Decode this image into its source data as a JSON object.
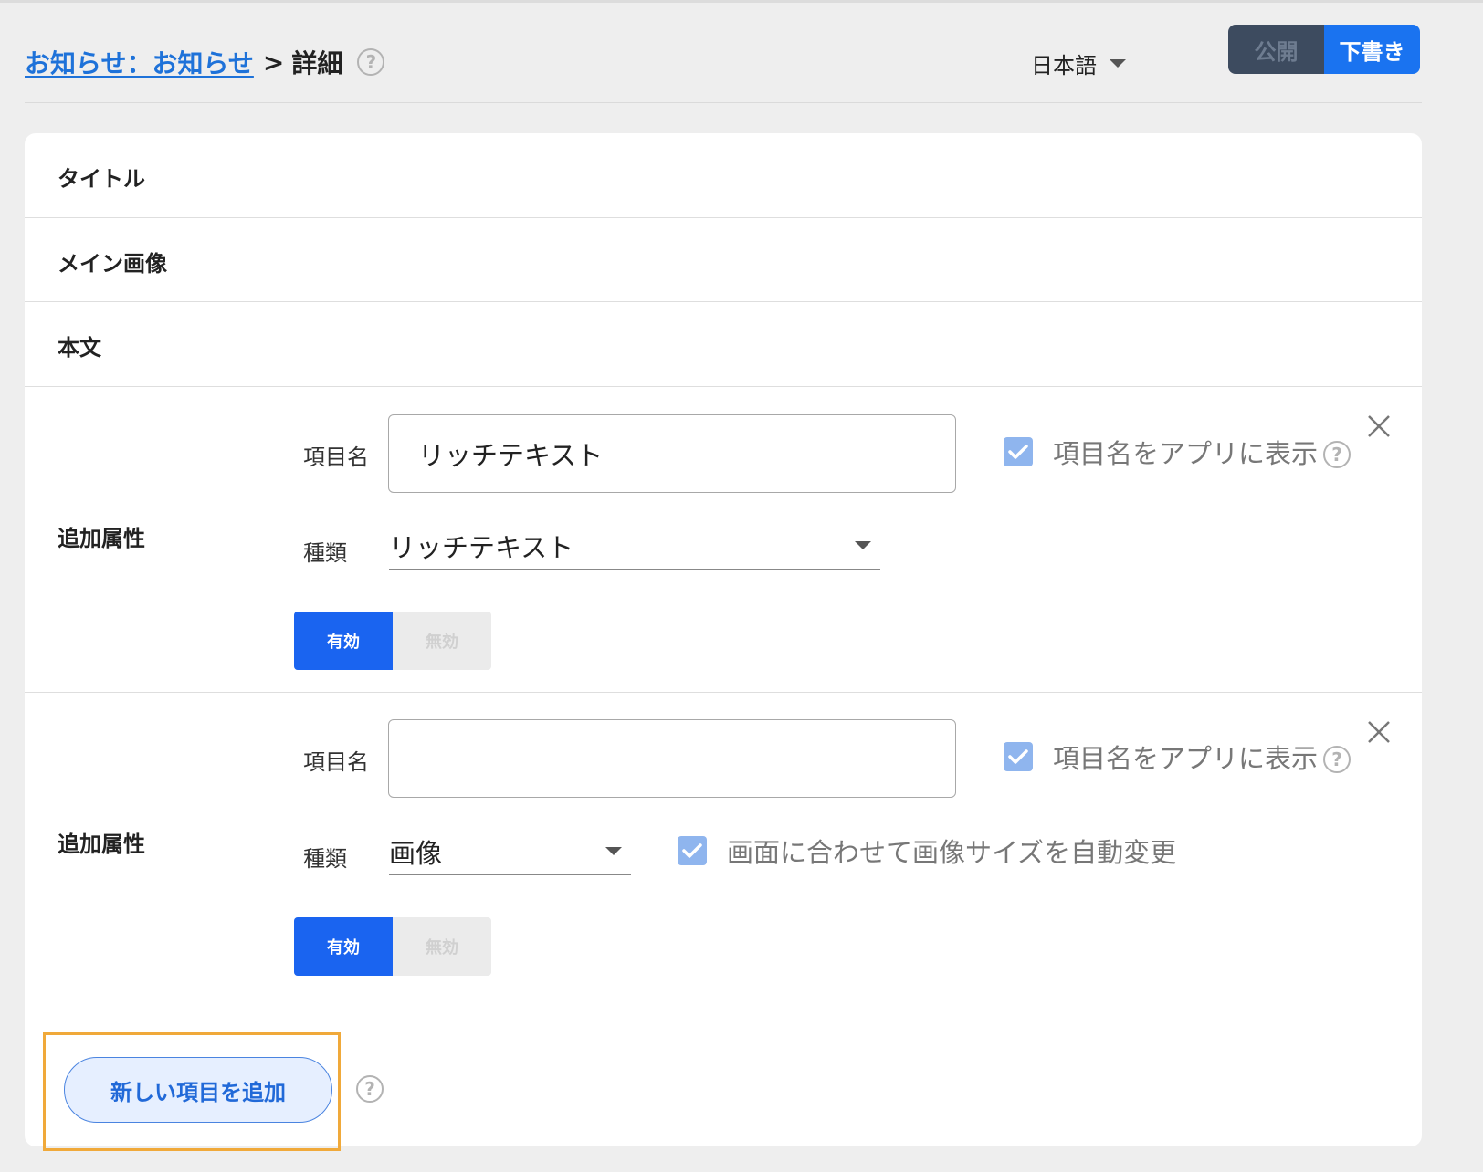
{
  "breadcrumb": {
    "link": "お知らせ：お知らせ ",
    "separator": ">",
    "current": "詳細",
    "help": "?"
  },
  "language": {
    "selected": "日本語"
  },
  "publish_toggle": {
    "publish_label": "公開",
    "draft_label": "下書き",
    "active": "下書き"
  },
  "sections": [
    {
      "label": "タイトル"
    },
    {
      "label": "メイン画像"
    },
    {
      "label": "本文"
    }
  ],
  "attributes": [
    {
      "label": "追加属性",
      "name_label": "項目名",
      "name_value": "リッチテキスト",
      "show_name_label": "項目名をアプリに表示",
      "show_name_checked": true,
      "type_label": "種類",
      "type_value": "リッチテキスト",
      "enabled_label": "有効",
      "disabled_label": "無効",
      "state": "有効"
    },
    {
      "label": "追加属性",
      "name_label": "項目名",
      "name_value": "",
      "show_name_label": "項目名をアプリに表示",
      "show_name_checked": true,
      "type_label": "種類",
      "type_value": "画像",
      "auto_resize_label": "画面に合わせて画像サイズを自動変更",
      "auto_resize_checked": true,
      "enabled_label": "有効",
      "disabled_label": "無効",
      "state": "有効"
    }
  ],
  "add_item": {
    "label": "新しい項目を追加",
    "help": "?"
  },
  "colors": {
    "accent": "#1a73f0",
    "link": "#1e72d9",
    "highlight": "#f0a93a",
    "checkbox": "#8fb5ee"
  }
}
